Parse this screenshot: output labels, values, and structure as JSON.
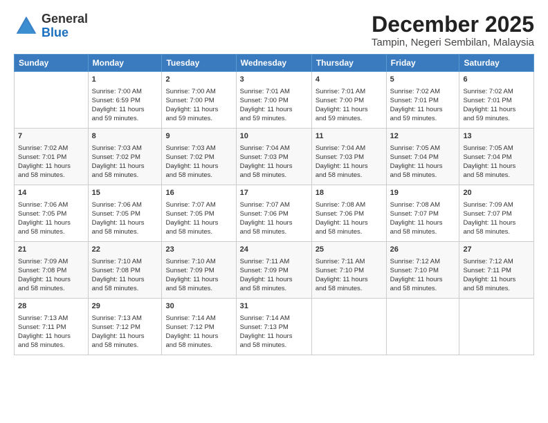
{
  "logo": {
    "general": "General",
    "blue": "Blue"
  },
  "title": "December 2025",
  "subtitle": "Tampin, Negeri Sembilan, Malaysia",
  "days_header": [
    "Sunday",
    "Monday",
    "Tuesday",
    "Wednesday",
    "Thursday",
    "Friday",
    "Saturday"
  ],
  "weeks": [
    [
      {
        "num": "",
        "lines": []
      },
      {
        "num": "1",
        "lines": [
          "Sunrise: 7:00 AM",
          "Sunset: 6:59 PM",
          "Daylight: 11 hours",
          "and 59 minutes."
        ]
      },
      {
        "num": "2",
        "lines": [
          "Sunrise: 7:00 AM",
          "Sunset: 7:00 PM",
          "Daylight: 11 hours",
          "and 59 minutes."
        ]
      },
      {
        "num": "3",
        "lines": [
          "Sunrise: 7:01 AM",
          "Sunset: 7:00 PM",
          "Daylight: 11 hours",
          "and 59 minutes."
        ]
      },
      {
        "num": "4",
        "lines": [
          "Sunrise: 7:01 AM",
          "Sunset: 7:00 PM",
          "Daylight: 11 hours",
          "and 59 minutes."
        ]
      },
      {
        "num": "5",
        "lines": [
          "Sunrise: 7:02 AM",
          "Sunset: 7:01 PM",
          "Daylight: 11 hours",
          "and 59 minutes."
        ]
      },
      {
        "num": "6",
        "lines": [
          "Sunrise: 7:02 AM",
          "Sunset: 7:01 PM",
          "Daylight: 11 hours",
          "and 59 minutes."
        ]
      }
    ],
    [
      {
        "num": "7",
        "lines": [
          "Sunrise: 7:02 AM",
          "Sunset: 7:01 PM",
          "Daylight: 11 hours",
          "and 58 minutes."
        ]
      },
      {
        "num": "8",
        "lines": [
          "Sunrise: 7:03 AM",
          "Sunset: 7:02 PM",
          "Daylight: 11 hours",
          "and 58 minutes."
        ]
      },
      {
        "num": "9",
        "lines": [
          "Sunrise: 7:03 AM",
          "Sunset: 7:02 PM",
          "Daylight: 11 hours",
          "and 58 minutes."
        ]
      },
      {
        "num": "10",
        "lines": [
          "Sunrise: 7:04 AM",
          "Sunset: 7:03 PM",
          "Daylight: 11 hours",
          "and 58 minutes."
        ]
      },
      {
        "num": "11",
        "lines": [
          "Sunrise: 7:04 AM",
          "Sunset: 7:03 PM",
          "Daylight: 11 hours",
          "and 58 minutes."
        ]
      },
      {
        "num": "12",
        "lines": [
          "Sunrise: 7:05 AM",
          "Sunset: 7:04 PM",
          "Daylight: 11 hours",
          "and 58 minutes."
        ]
      },
      {
        "num": "13",
        "lines": [
          "Sunrise: 7:05 AM",
          "Sunset: 7:04 PM",
          "Daylight: 11 hours",
          "and 58 minutes."
        ]
      }
    ],
    [
      {
        "num": "14",
        "lines": [
          "Sunrise: 7:06 AM",
          "Sunset: 7:05 PM",
          "Daylight: 11 hours",
          "and 58 minutes."
        ]
      },
      {
        "num": "15",
        "lines": [
          "Sunrise: 7:06 AM",
          "Sunset: 7:05 PM",
          "Daylight: 11 hours",
          "and 58 minutes."
        ]
      },
      {
        "num": "16",
        "lines": [
          "Sunrise: 7:07 AM",
          "Sunset: 7:05 PM",
          "Daylight: 11 hours",
          "and 58 minutes."
        ]
      },
      {
        "num": "17",
        "lines": [
          "Sunrise: 7:07 AM",
          "Sunset: 7:06 PM",
          "Daylight: 11 hours",
          "and 58 minutes."
        ]
      },
      {
        "num": "18",
        "lines": [
          "Sunrise: 7:08 AM",
          "Sunset: 7:06 PM",
          "Daylight: 11 hours",
          "and 58 minutes."
        ]
      },
      {
        "num": "19",
        "lines": [
          "Sunrise: 7:08 AM",
          "Sunset: 7:07 PM",
          "Daylight: 11 hours",
          "and 58 minutes."
        ]
      },
      {
        "num": "20",
        "lines": [
          "Sunrise: 7:09 AM",
          "Sunset: 7:07 PM",
          "Daylight: 11 hours",
          "and 58 minutes."
        ]
      }
    ],
    [
      {
        "num": "21",
        "lines": [
          "Sunrise: 7:09 AM",
          "Sunset: 7:08 PM",
          "Daylight: 11 hours",
          "and 58 minutes."
        ]
      },
      {
        "num": "22",
        "lines": [
          "Sunrise: 7:10 AM",
          "Sunset: 7:08 PM",
          "Daylight: 11 hours",
          "and 58 minutes."
        ]
      },
      {
        "num": "23",
        "lines": [
          "Sunrise: 7:10 AM",
          "Sunset: 7:09 PM",
          "Daylight: 11 hours",
          "and 58 minutes."
        ]
      },
      {
        "num": "24",
        "lines": [
          "Sunrise: 7:11 AM",
          "Sunset: 7:09 PM",
          "Daylight: 11 hours",
          "and 58 minutes."
        ]
      },
      {
        "num": "25",
        "lines": [
          "Sunrise: 7:11 AM",
          "Sunset: 7:10 PM",
          "Daylight: 11 hours",
          "and 58 minutes."
        ]
      },
      {
        "num": "26",
        "lines": [
          "Sunrise: 7:12 AM",
          "Sunset: 7:10 PM",
          "Daylight: 11 hours",
          "and 58 minutes."
        ]
      },
      {
        "num": "27",
        "lines": [
          "Sunrise: 7:12 AM",
          "Sunset: 7:11 PM",
          "Daylight: 11 hours",
          "and 58 minutes."
        ]
      }
    ],
    [
      {
        "num": "28",
        "lines": [
          "Sunrise: 7:13 AM",
          "Sunset: 7:11 PM",
          "Daylight: 11 hours",
          "and 58 minutes."
        ]
      },
      {
        "num": "29",
        "lines": [
          "Sunrise: 7:13 AM",
          "Sunset: 7:12 PM",
          "Daylight: 11 hours",
          "and 58 minutes."
        ]
      },
      {
        "num": "30",
        "lines": [
          "Sunrise: 7:14 AM",
          "Sunset: 7:12 PM",
          "Daylight: 11 hours",
          "and 58 minutes."
        ]
      },
      {
        "num": "31",
        "lines": [
          "Sunrise: 7:14 AM",
          "Sunset: 7:13 PM",
          "Daylight: 11 hours",
          "and 58 minutes."
        ]
      },
      {
        "num": "",
        "lines": []
      },
      {
        "num": "",
        "lines": []
      },
      {
        "num": "",
        "lines": []
      }
    ]
  ]
}
